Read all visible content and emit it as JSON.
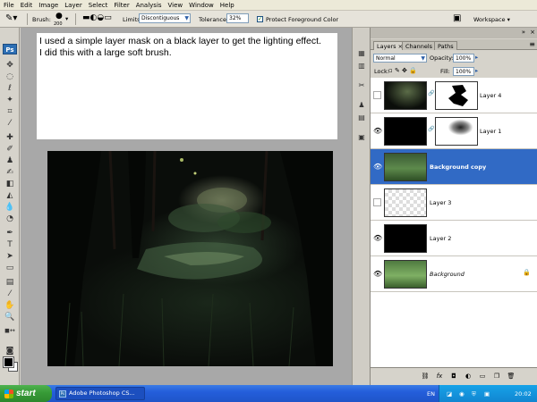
{
  "menu": [
    "File",
    "Edit",
    "Image",
    "Layer",
    "Select",
    "Filter",
    "Analysis",
    "View",
    "Window",
    "Help"
  ],
  "options": {
    "brush_label": "Brush:",
    "brush_size": "200",
    "limits_label": "Limits:",
    "limits_value": "Discontiguous",
    "tolerance_label": "Tolerance:",
    "tolerance_value": "32%",
    "protect_fg_label": "Protect Foreground Color",
    "workspace_label": "Workspace ▾"
  },
  "toolbox": {
    "logo": "Ps"
  },
  "note": {
    "line1": "I used a simple layer mask on a black layer to get the lighting effect.",
    "line2": "I did this with a large soft brush."
  },
  "layers_panel": {
    "tabs": [
      "Layers ×",
      "Channels",
      "Paths"
    ],
    "blend_mode": "Normal",
    "opacity_label": "Opacity:",
    "opacity_value": "100%",
    "lock_label": "Lock:",
    "fill_label": "Fill:",
    "fill_value": "100%",
    "layers": [
      {
        "name": "Layer 4",
        "visible": false,
        "has_mask": true,
        "selected": false
      },
      {
        "name": "Layer 1",
        "visible": true,
        "has_mask": true,
        "selected": false
      },
      {
        "name": "Background copy",
        "visible": true,
        "has_mask": false,
        "selected": true
      },
      {
        "name": "Layer 3",
        "visible": false,
        "has_mask": false,
        "selected": false
      },
      {
        "name": "Layer 2",
        "visible": true,
        "has_mask": false,
        "selected": false
      },
      {
        "name": "Background",
        "visible": true,
        "has_mask": false,
        "selected": false,
        "locked": true
      }
    ]
  },
  "taskbar": {
    "start": "start",
    "task": "Adobe Photoshop CS...",
    "lang": "EN",
    "clock": "20:02"
  },
  "colors": {
    "selection": "#316ac5",
    "taskbar": "#245edb",
    "start": "#379b37"
  }
}
